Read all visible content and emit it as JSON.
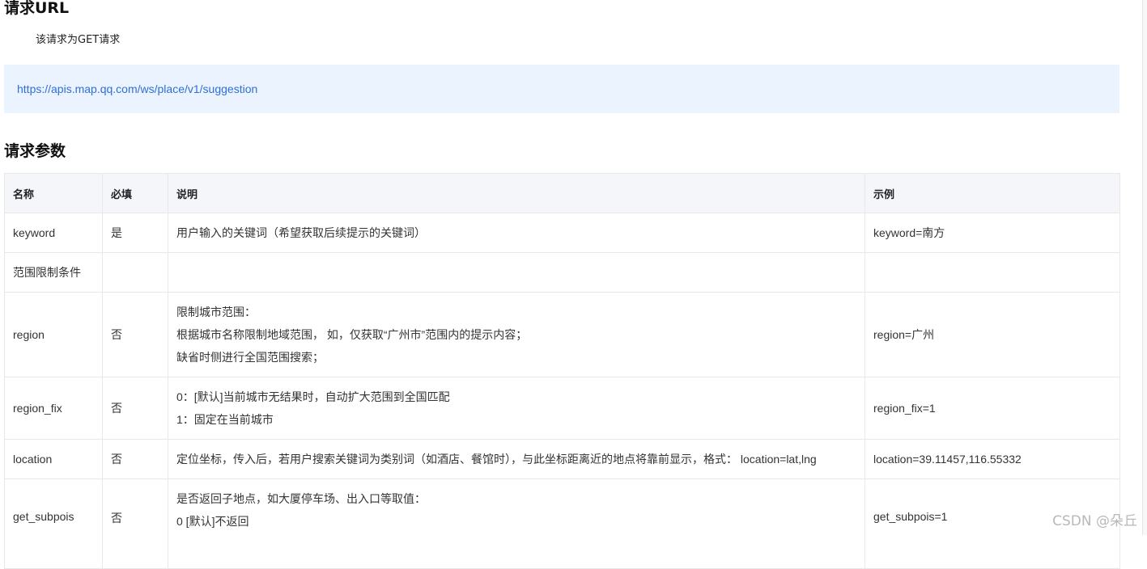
{
  "url_section": {
    "heading": "请求URL",
    "description": "该请求为GET请求",
    "url": "https://apis.map.qq.com/ws/place/v1/suggestion"
  },
  "params_section": {
    "heading": "请求参数",
    "columns": [
      "名称",
      "必填",
      "说明",
      "示例"
    ],
    "rows": [
      {
        "name": "keyword",
        "required": "是",
        "desc": [
          "用户输入的关键词（希望获取后续提示的关键词）"
        ],
        "example": "keyword=南方"
      },
      {
        "name": "范围限制条件",
        "required": "",
        "desc": [
          ""
        ],
        "example": ""
      },
      {
        "name": "region",
        "required": "否",
        "desc": [
          "限制城市范围：",
          "根据城市名称限制地域范围， 如，仅获取“广州市”范围内的提示内容；",
          "缺省时侧进行全国范围搜索；"
        ],
        "example": "region=广州"
      },
      {
        "name": "region_fix",
        "required": "否",
        "desc": [
          "0：[默认]当前城市无结果时，自动扩大范围到全国匹配",
          "1：固定在当前城市"
        ],
        "example": "region_fix=1"
      },
      {
        "name": "location",
        "required": "否",
        "desc": [
          "定位坐标，传入后，若用户搜索关键词为类别词（如酒店、餐馆时），与此坐标距离近的地点将靠前显示，格式： location=lat,lng"
        ],
        "example": "location=39.11457,116.55332"
      },
      {
        "name": "get_subpois",
        "required": "否",
        "desc": [
          "是否返回子地点，如大厦停车场、出入口等取值：",
          "0 [默认]不返回"
        ],
        "example": "get_subpois=1"
      }
    ]
  },
  "watermark": "CSDN @朵丘"
}
